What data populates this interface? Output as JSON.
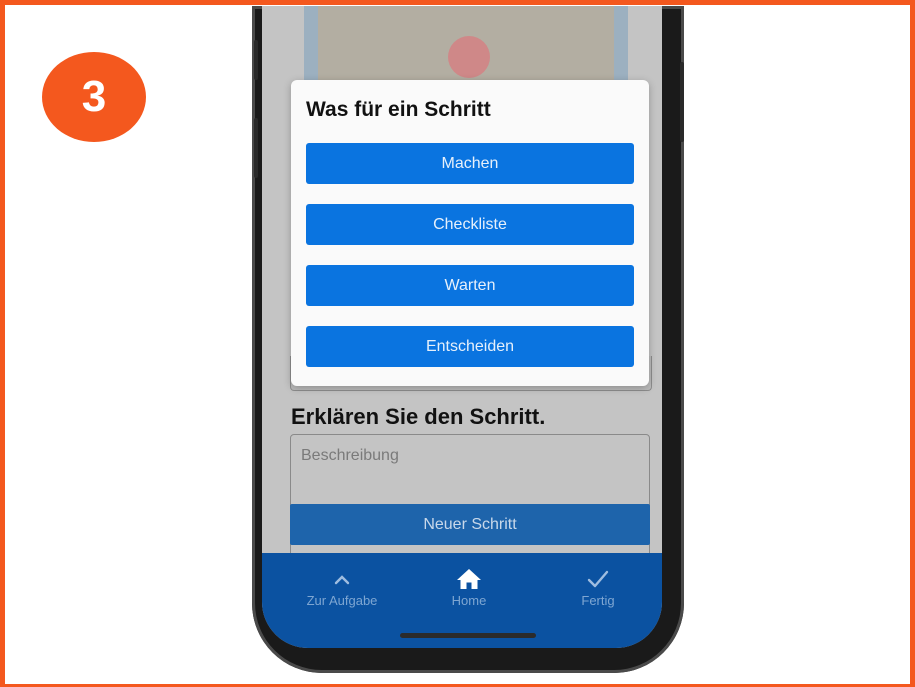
{
  "step_number": "3",
  "dialog": {
    "title": "Was für ein Schritt",
    "options": [
      "Machen",
      "Checkliste",
      "Warten",
      "Entscheiden"
    ]
  },
  "form": {
    "section_title": "Erklären Sie den Schritt.",
    "description_placeholder": "Beschreibung",
    "new_step_label": "Neuer Schritt"
  },
  "bottom_nav": {
    "items": [
      {
        "label": "Zur Aufgabe",
        "icon": "chevron-up-icon"
      },
      {
        "label": "Home",
        "icon": "home-icon"
      },
      {
        "label": "Fertig",
        "icon": "checkmark-icon"
      }
    ]
  },
  "colors": {
    "accent": "#f4581e",
    "button_blue": "#0a74e0",
    "nav_blue": "#0b52a1"
  }
}
